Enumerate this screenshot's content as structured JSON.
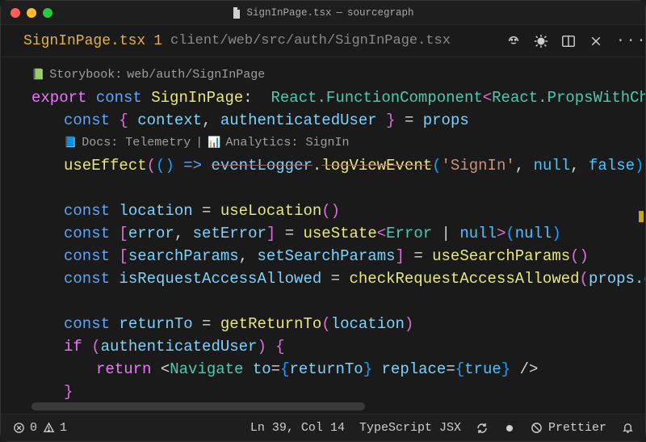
{
  "window": {
    "title_file": "SignInPage.tsx",
    "title_sep": "—",
    "title_project": "sourcegraph"
  },
  "tab": {
    "filename": "SignInPage.tsx",
    "dirty_indicator": "1",
    "path": "client/web/src/auth/SignInPage.tsx"
  },
  "toolbar_icons": {
    "smile": "smile-icon",
    "sun": "sun-icon",
    "split": "split-icon",
    "close": "close-icon",
    "more": "more-icon"
  },
  "codelens": {
    "storybook_prefix": "Storybook:",
    "storybook_path": "web/auth/SignInPage",
    "docs_label": "Docs: Telemetry",
    "sep": "|",
    "analytics_label": "Analytics: SignIn"
  },
  "code": {
    "export": "export",
    "const": "const",
    "componentName": "SignInPage",
    "colon": ":",
    "reactFC": "React.FunctionComponent",
    "lt": "<",
    "propsType": "React.PropsWithChil",
    "l2_a": "const",
    "l2_brace_open": "{",
    "l2_context": "context",
    "l2_comma": ",",
    "l2_authUser": "authenticatedUser",
    "l2_brace_close": "}",
    "l2_eq": "=",
    "l2_props": "props",
    "useEffect": "useEffect",
    "arrow_open": "((",
    "arrow_paren": ")",
    "arrow": "=>",
    "eventLogger": "eventLogger",
    "dot": ".",
    "logViewEvent": "logViewEvent",
    "sig_open": "(",
    "str_signin": "'SignIn'",
    "null": "null",
    "false": "false",
    "sig_close": "))",
    "location": "location",
    "useLocation": "useLocation",
    "empty_call": "()",
    "lbracket": "[",
    "rbracket": "]",
    "error": "error",
    "setError": "setError",
    "useState": "useState",
    "ErrorT": "Error",
    "pipe": "|",
    "nullv": "null",
    "gt": ">",
    "searchParams": "searchParams",
    "setSearchParams": "setSearchParams",
    "useSearchParams": "useSearchParams",
    "isRequestAccessAllowed": "isRequestAccessAllowed",
    "checkRequestAccessAllowed": "checkRequestAccessAllowed",
    "props_c": "props.c",
    "returnTo": "returnTo",
    "getReturnTo": "getReturnTo",
    "if": "if",
    "authenticatedUser2": "authenticatedUser",
    "return": "return",
    "Navigate": "Navigate",
    "to_attr": "to",
    "eq": "=",
    "replace_attr": "replace",
    "true": "true",
    "selfclose": "/>"
  },
  "status": {
    "errors": "0",
    "warnings": "1",
    "ln_col": "Ln 39, Col 14",
    "lang": "TypeScript JSX",
    "prettier": "Prettier"
  }
}
